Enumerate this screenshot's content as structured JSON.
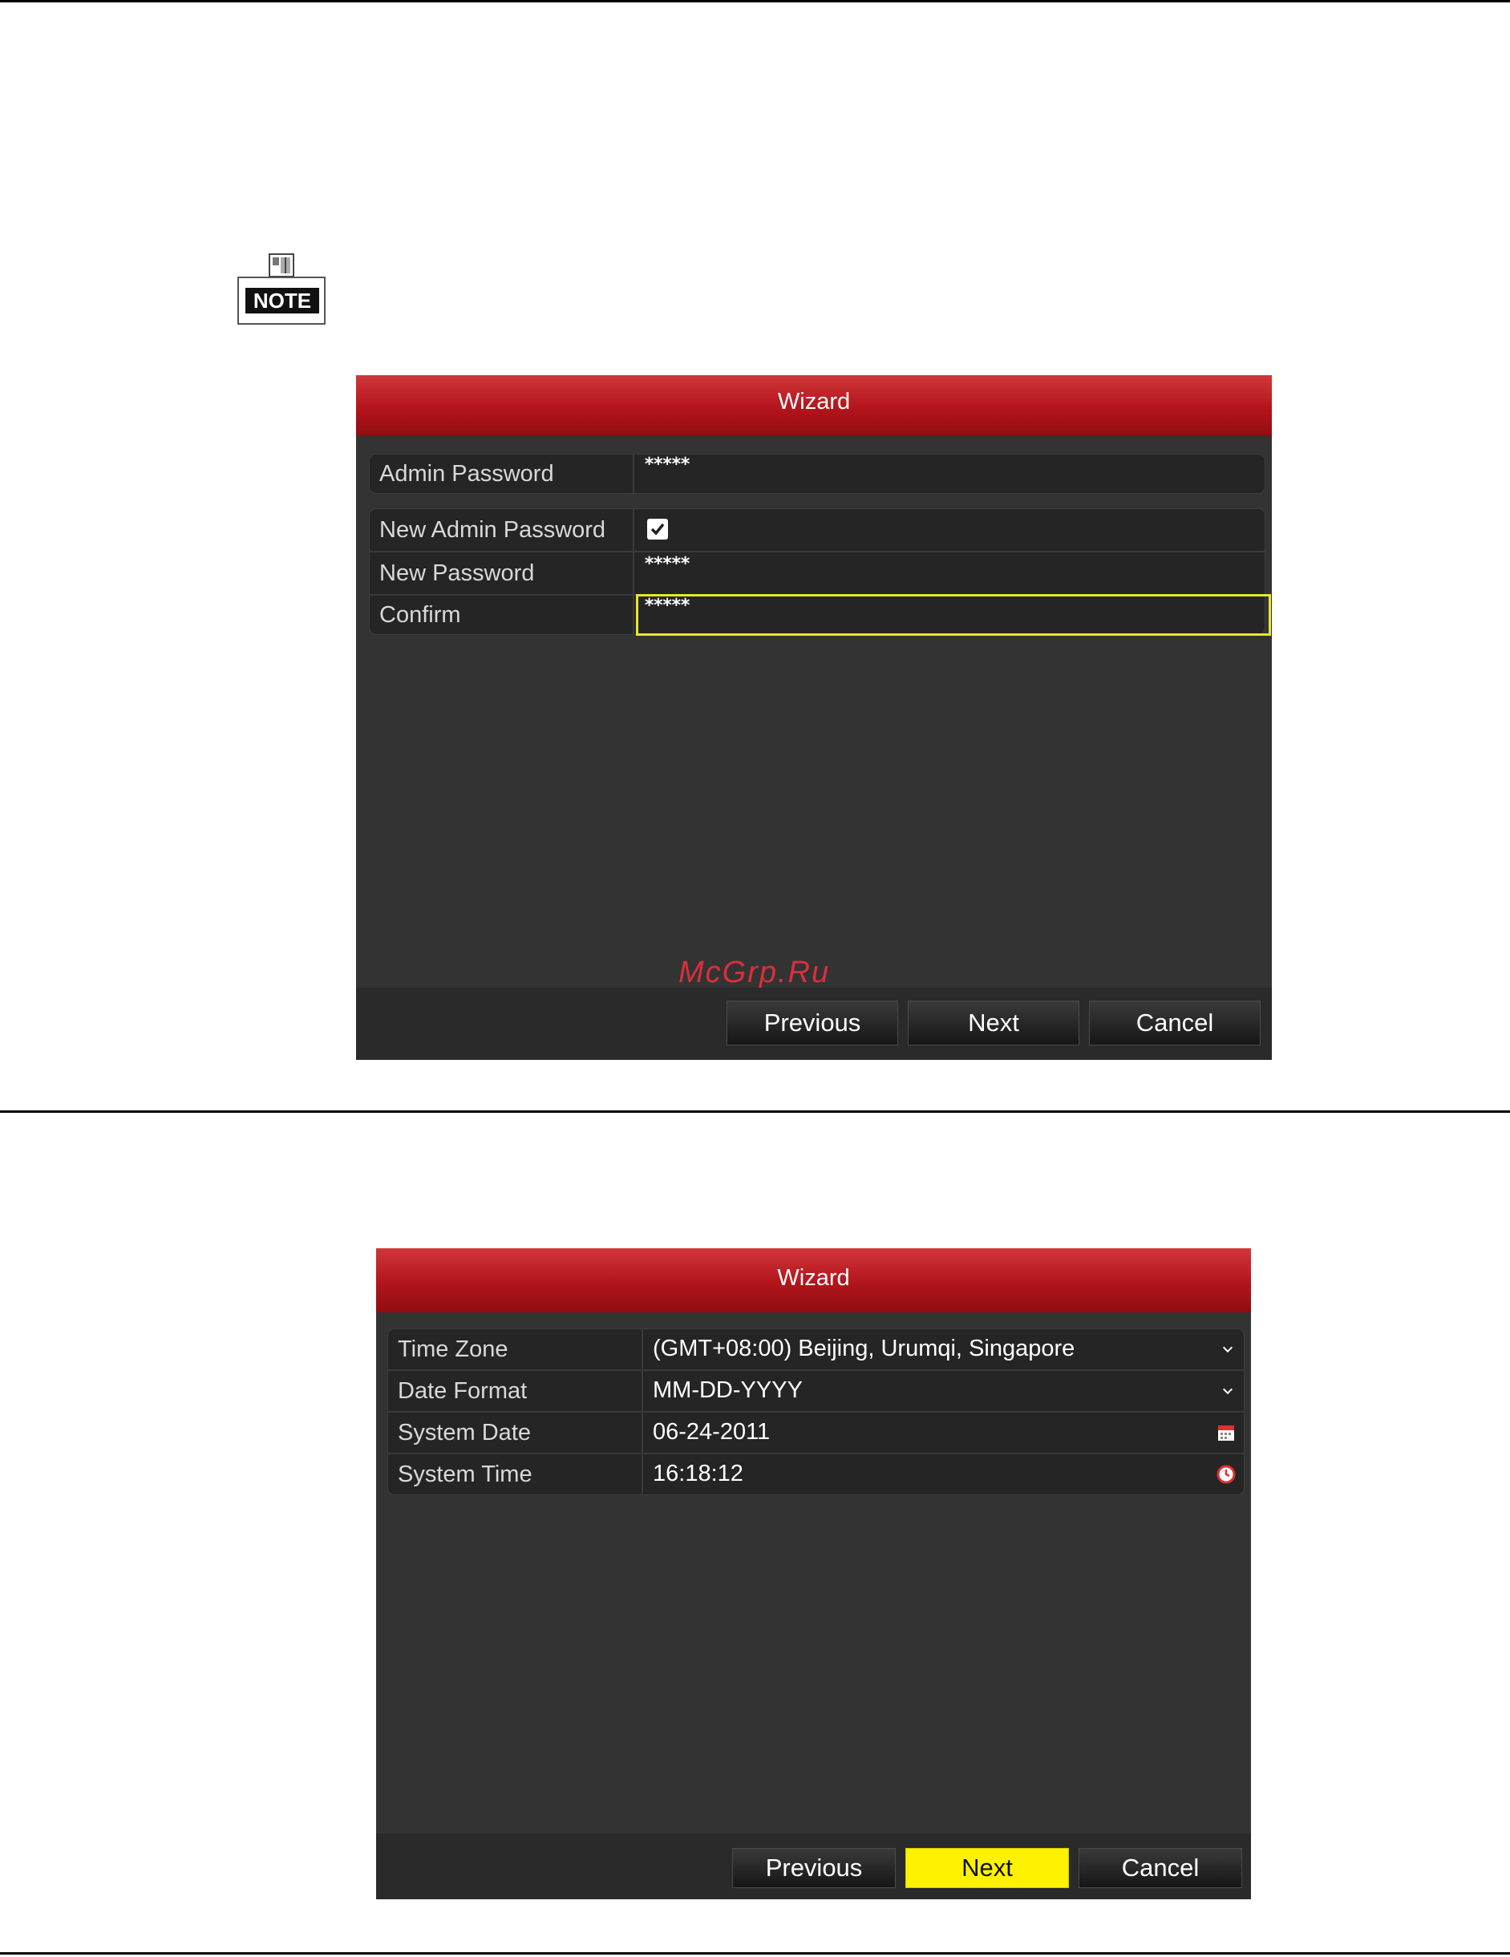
{
  "note": {
    "label": "NOTE"
  },
  "wizard1": {
    "title": "Wizard",
    "rows": {
      "admin_password": {
        "label": "Admin Password",
        "value": "*****"
      },
      "new_admin_password": {
        "label": "New Admin Password",
        "checked": true
      },
      "new_password": {
        "label": "New Password",
        "value": "*****"
      },
      "confirm": {
        "label": "Confirm",
        "value": "*****"
      }
    },
    "buttons": {
      "previous": "Previous",
      "next": "Next",
      "cancel": "Cancel"
    },
    "watermark": "McGrp.Ru"
  },
  "wizard2": {
    "title": "Wizard",
    "rows": {
      "time_zone": {
        "label": "Time Zone",
        "value": "(GMT+08:00) Beijing, Urumqi, Singapore"
      },
      "date_format": {
        "label": "Date Format",
        "value": "MM-DD-YYYY"
      },
      "system_date": {
        "label": "System Date",
        "value": "06-24-2011"
      },
      "system_time": {
        "label": "System Time",
        "value": "16:18:12"
      }
    },
    "buttons": {
      "previous": "Previous",
      "next": "Next",
      "cancel": "Cancel"
    }
  },
  "colors": {
    "title_red": "#b3141b",
    "focus_yellow": "#e8e82c",
    "primary_button": "#fff200",
    "panel": "#333333"
  },
  "icons": [
    "note-icon",
    "checkbox-checked-icon",
    "chevron-down-icon",
    "calendar-icon",
    "clock-icon"
  ]
}
